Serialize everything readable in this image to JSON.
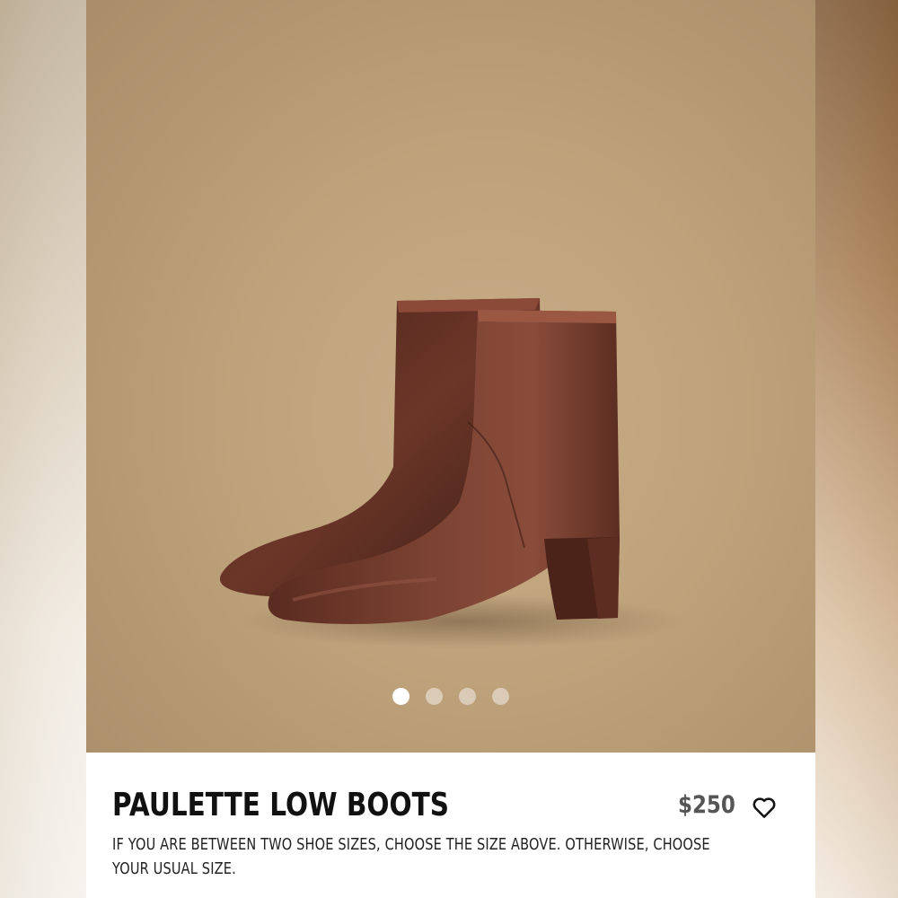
{
  "product": {
    "name": "PAULETTE LOW BOOTS",
    "price": "$250",
    "size_note": "IF YOU ARE BETWEEN TWO SHOE SIZES, CHOOSE THE SIZE ABOVE. OTHERWISE, CHOOSE YOUR USUAL SIZE."
  },
  "gallery": {
    "image_count": 4,
    "active_index": 0
  },
  "icons": {
    "favorite": "heart-outline-icon"
  },
  "colors": {
    "background": "#bea27b",
    "boot_leather": "#5a2e23",
    "text": "#111111",
    "price": "#555555"
  }
}
